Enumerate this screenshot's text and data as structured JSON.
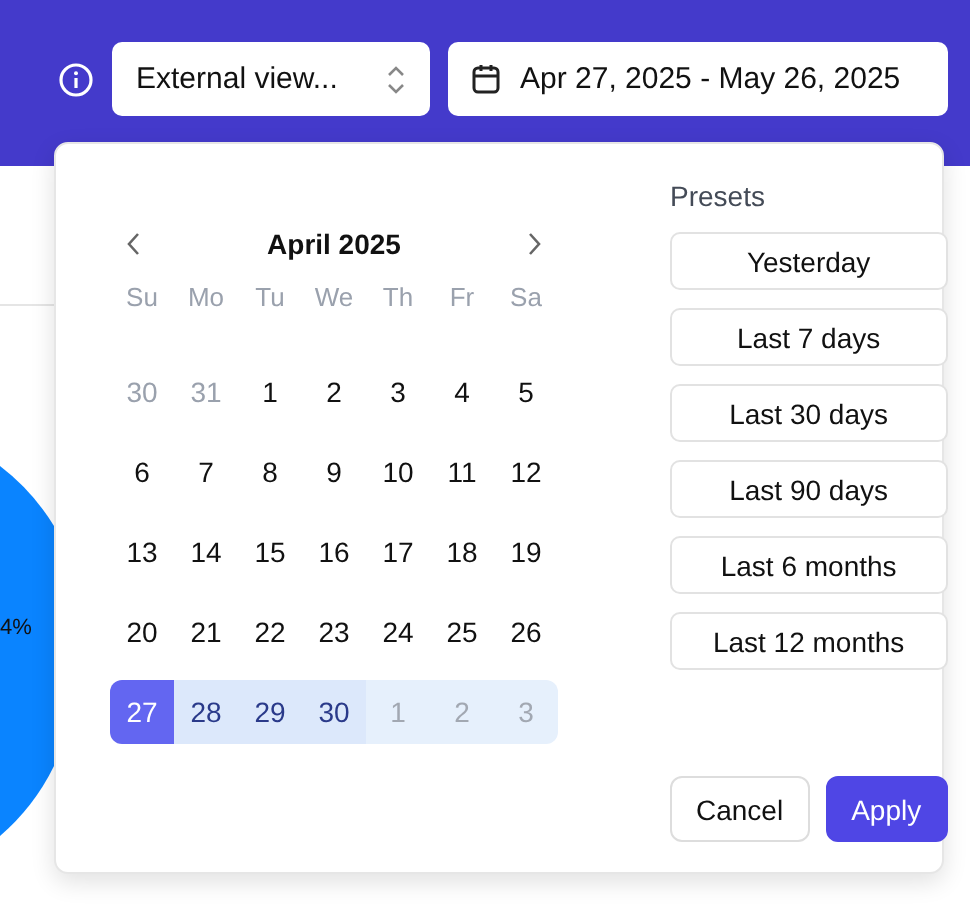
{
  "header": {
    "view_select": {
      "value": "External view..."
    },
    "date_range": {
      "value": "Apr 27, 2025 - May 26, 2025"
    }
  },
  "background": {
    "chart_label": "4%"
  },
  "date_picker": {
    "month": "April 2025",
    "weekdays": [
      "Su",
      "Mo",
      "Tu",
      "We",
      "Th",
      "Fr",
      "Sa"
    ],
    "days": [
      {
        "label": "30",
        "outside": true,
        "selected": false,
        "in_range": false
      },
      {
        "label": "31",
        "outside": true,
        "selected": false,
        "in_range": false
      },
      {
        "label": "1",
        "outside": false,
        "selected": false,
        "in_range": false
      },
      {
        "label": "2",
        "outside": false,
        "selected": false,
        "in_range": false
      },
      {
        "label": "3",
        "outside": false,
        "selected": false,
        "in_range": false
      },
      {
        "label": "4",
        "outside": false,
        "selected": false,
        "in_range": false
      },
      {
        "label": "5",
        "outside": false,
        "selected": false,
        "in_range": false
      },
      {
        "label": "6",
        "outside": false,
        "selected": false,
        "in_range": false
      },
      {
        "label": "7",
        "outside": false,
        "selected": false,
        "in_range": false
      },
      {
        "label": "8",
        "outside": false,
        "selected": false,
        "in_range": false
      },
      {
        "label": "9",
        "outside": false,
        "selected": false,
        "in_range": false
      },
      {
        "label": "10",
        "outside": false,
        "selected": false,
        "in_range": false
      },
      {
        "label": "11",
        "outside": false,
        "selected": false,
        "in_range": false
      },
      {
        "label": "12",
        "outside": false,
        "selected": false,
        "in_range": false
      },
      {
        "label": "13",
        "outside": false,
        "selected": false,
        "in_range": false
      },
      {
        "label": "14",
        "outside": false,
        "selected": false,
        "in_range": false
      },
      {
        "label": "15",
        "outside": false,
        "selected": false,
        "in_range": false
      },
      {
        "label": "16",
        "outside": false,
        "selected": false,
        "in_range": false
      },
      {
        "label": "17",
        "outside": false,
        "selected": false,
        "in_range": false
      },
      {
        "label": "18",
        "outside": false,
        "selected": false,
        "in_range": false
      },
      {
        "label": "19",
        "outside": false,
        "selected": false,
        "in_range": false
      },
      {
        "label": "20",
        "outside": false,
        "selected": false,
        "in_range": false
      },
      {
        "label": "21",
        "outside": false,
        "selected": false,
        "in_range": false
      },
      {
        "label": "22",
        "outside": false,
        "selected": false,
        "in_range": false
      },
      {
        "label": "23",
        "outside": false,
        "selected": false,
        "in_range": false
      },
      {
        "label": "24",
        "outside": false,
        "selected": false,
        "in_range": false
      },
      {
        "label": "25",
        "outside": false,
        "selected": false,
        "in_range": false
      },
      {
        "label": "26",
        "outside": false,
        "selected": false,
        "in_range": false
      },
      {
        "label": "27",
        "outside": false,
        "selected": true,
        "in_range": true
      },
      {
        "label": "28",
        "outside": false,
        "selected": false,
        "in_range": true
      },
      {
        "label": "29",
        "outside": false,
        "selected": false,
        "in_range": true
      },
      {
        "label": "30",
        "outside": false,
        "selected": false,
        "in_range": true
      },
      {
        "label": "1",
        "outside": true,
        "selected": false,
        "in_range": true
      },
      {
        "label": "2",
        "outside": true,
        "selected": false,
        "in_range": true
      },
      {
        "label": "3",
        "outside": true,
        "selected": false,
        "in_range": true
      }
    ],
    "presets_title": "Presets",
    "presets": [
      "Yesterday",
      "Last 7 days",
      "Last 30 days",
      "Last 90 days",
      "Last 6 months",
      "Last 12 months"
    ],
    "buttons": [
      {
        "label": "Cancel",
        "kind": "secondary"
      },
      {
        "label": "Apply",
        "kind": "primary"
      }
    ]
  }
}
